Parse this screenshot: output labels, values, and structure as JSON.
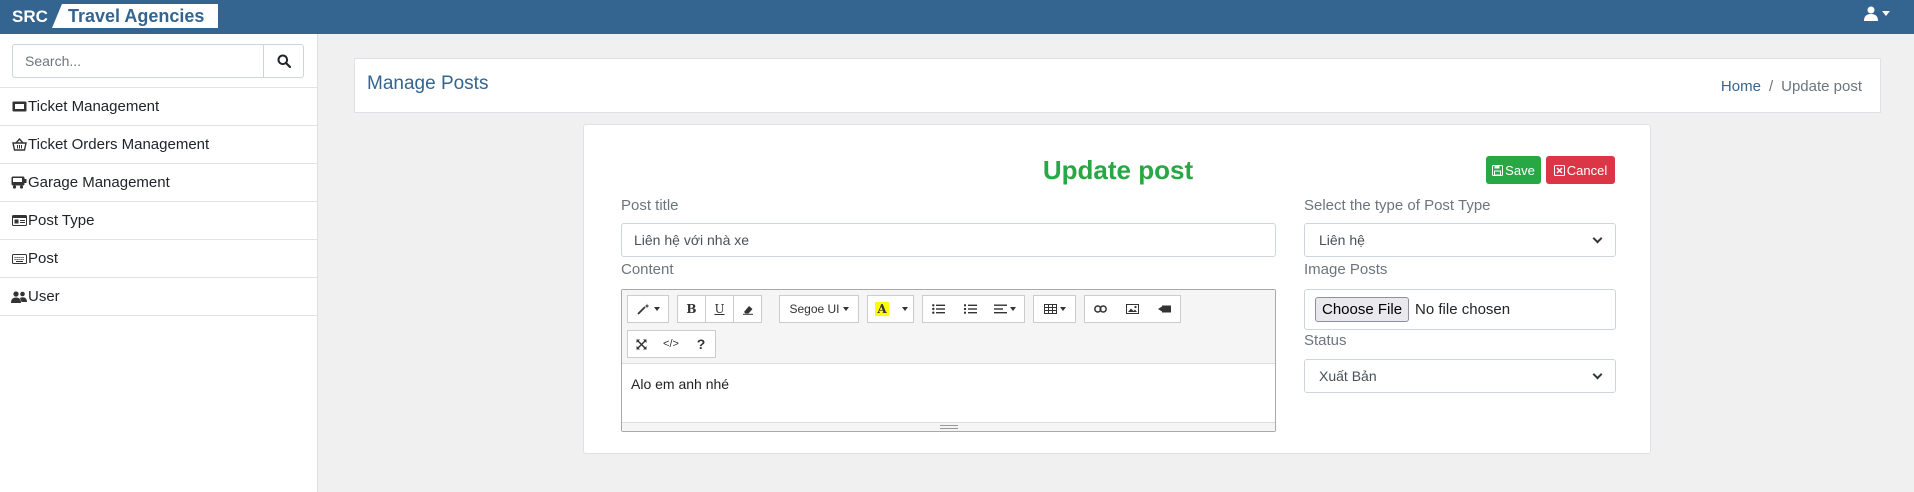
{
  "navbar": {
    "brand_short": "SRC",
    "brand_title": "Travel Agencies",
    "user_icon": "user-icon"
  },
  "sidebar": {
    "search": {
      "placeholder": "Search...",
      "value": ""
    },
    "items": [
      {
        "label": "Ticket Management",
        "icon": "ticket-icon"
      },
      {
        "label": "Ticket Orders Management",
        "icon": "basket-icon"
      },
      {
        "label": "Garage Management",
        "icon": "bus-icon"
      },
      {
        "label": "Post Type",
        "icon": "id-card-icon"
      },
      {
        "label": "Post",
        "icon": "keyboard-icon"
      },
      {
        "label": "User",
        "icon": "users-icon"
      }
    ]
  },
  "header": {
    "title": "Manage Posts",
    "breadcrumb": {
      "home": "Home",
      "separator": "/",
      "current": "Update post"
    }
  },
  "form": {
    "heading": "Update post",
    "save_label": "Save",
    "cancel_label": "Cancel",
    "post_title_label": "Post title",
    "post_title_value": "Liên hệ với nhà xe",
    "content_label": "Content",
    "content_value": "Alo em anh nhé",
    "post_type_label": "Select the type of Post Type",
    "post_type_value": "Liên hệ",
    "image_label": "Image Posts",
    "choose_file_label": "Choose File",
    "no_file_text": "No file chosen",
    "status_label": "Status",
    "status_value": "Xuất Bản"
  },
  "editor_toolbar": {
    "font_name": "Segoe UI",
    "help": "?",
    "code_view": "</>"
  },
  "colors": {
    "navbar": "#346590",
    "heading": "#28a745",
    "save": "#28a745",
    "cancel": "#dc3545"
  }
}
